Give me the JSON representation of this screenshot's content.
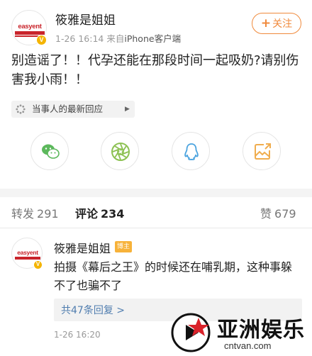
{
  "post": {
    "author_name": "筱雅是姐姐",
    "avatar_logo_text": "easyent",
    "verified_badge": "V",
    "time": "1-26 16:14",
    "source_prefix": "来自",
    "source": "iPhone客户端",
    "follow_button": "关注",
    "text": "别造谣了！！代孕还能在那段时间一起吸奶?请别伤害我小雨！！",
    "latest_chip": "当事人的最新回应",
    "share_icons": [
      "wechat-icon",
      "moments-icon",
      "qq-icon",
      "qzone-icon"
    ]
  },
  "tabs": [
    {
      "label": "转发",
      "count": "291"
    },
    {
      "label": "评论",
      "count": "234"
    },
    {
      "label": "赞",
      "count": "679"
    }
  ],
  "comment": {
    "author_name": "筱雅是姐姐",
    "avatar_logo_text": "easyent",
    "verified_badge": "V",
    "badge": "博主",
    "text": "拍摄《幕后之王》的时候还在哺乳期，这种事躲不了也骗不了",
    "replies_link": "共47条回复 >",
    "time": "1-26 16:20"
  },
  "watermark": {
    "title": "亚洲娱乐",
    "url": "cntvan.com"
  },
  "colors": {
    "accent_orange": "#f08a3c",
    "link_blue": "#507daf",
    "brand_red": "#c9242b",
    "badge_gold": "#f7b239"
  }
}
